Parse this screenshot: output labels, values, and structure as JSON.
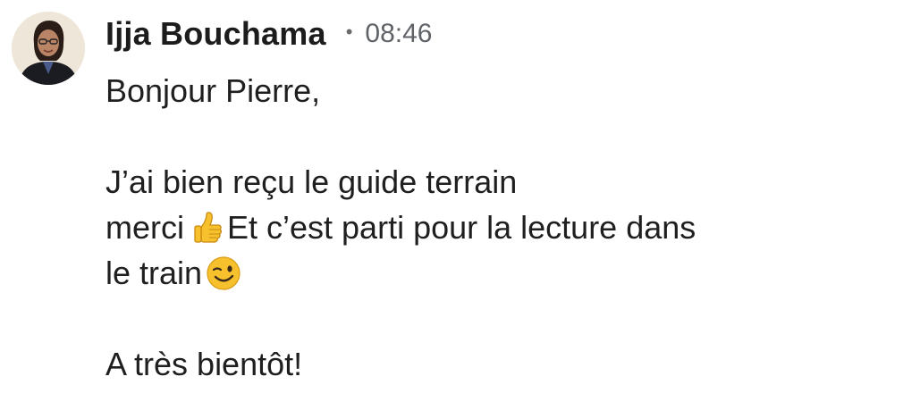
{
  "message": {
    "sender": "Ijja Bouchama",
    "separator": "•",
    "time": "08:46",
    "greeting": "Bonjour Pierre,",
    "line1": "J’ai bien reçu le guide terrain",
    "line2_before": "merci",
    "line2_after": "Et c’est parti pour la lecture dans",
    "line3": "le train",
    "signoff": "A très bientôt!",
    "emojis": [
      "thumbs-up-icon",
      "winking-face-icon"
    ]
  },
  "colors": {
    "name": "#1c1c1c",
    "timestamp": "#5f6368",
    "text": "#1f1f1f",
    "emoji": "#f6c12d"
  }
}
